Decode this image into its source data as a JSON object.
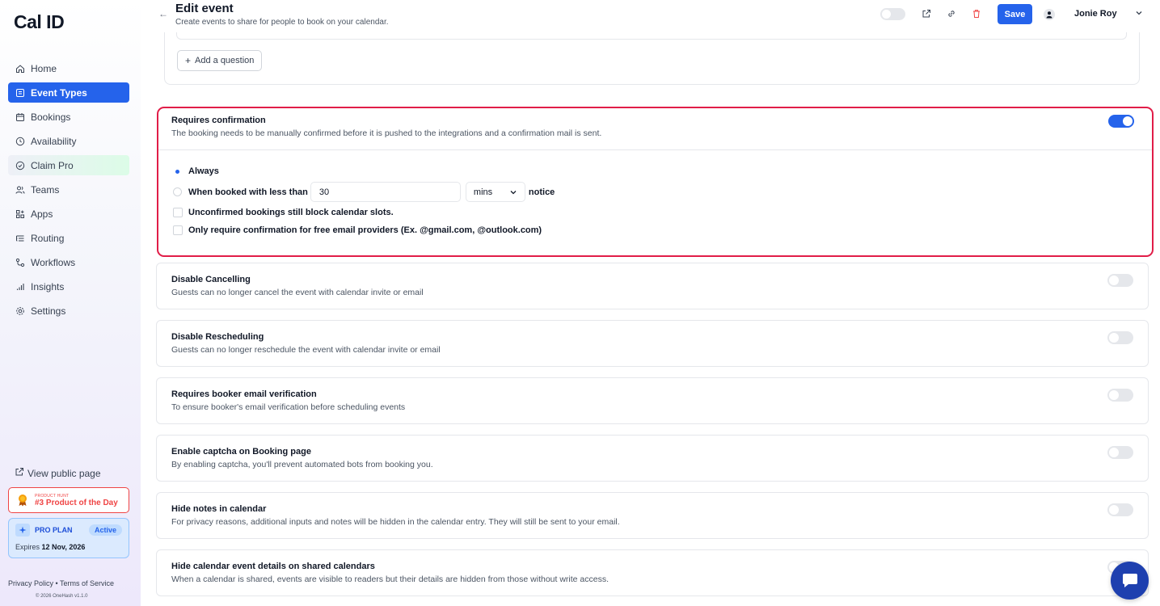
{
  "app": {
    "logo": "Cal ID"
  },
  "sidebar": {
    "items": [
      {
        "label": "Home",
        "icon": "home-icon"
      },
      {
        "label": "Event Types",
        "icon": "event-types-icon",
        "active": true
      },
      {
        "label": "Bookings",
        "icon": "calendar-icon"
      },
      {
        "label": "Availability",
        "icon": "clock-icon"
      },
      {
        "label": "Claim Pro",
        "icon": "badge-icon"
      },
      {
        "label": "Teams",
        "icon": "users-icon"
      },
      {
        "label": "Apps",
        "icon": "grid-plus-icon"
      },
      {
        "label": "Routing",
        "icon": "routing-icon"
      },
      {
        "label": "Workflows",
        "icon": "workflow-icon"
      },
      {
        "label": "Insights",
        "icon": "bar-chart-icon"
      },
      {
        "label": "Settings",
        "icon": "gear-icon"
      }
    ],
    "view_public": "View public page",
    "product_hunt": {
      "small": "PRODUCT HUNT",
      "big": "#3 Product of the Day"
    },
    "plan": {
      "name": "PRO PLAN",
      "status": "Active",
      "expires_label": "Expires",
      "expires_date": "12 Nov, 2026"
    },
    "footer": {
      "privacy": "Privacy Policy",
      "sep": "•",
      "terms": "Terms of Service",
      "copyright": "© 2026 OneHash v1.1.0"
    }
  },
  "header": {
    "back": "←",
    "title": "Edit event",
    "subtitle": "Create events to share for people to book on your calendar.",
    "save_label": "Save",
    "user_name": "Jonie Roy"
  },
  "questions": {
    "add_label": "Add a question"
  },
  "confirmation": {
    "title": "Requires confirmation",
    "desc": "The booking needs to be manually confirmed before it is pushed to the integrations and a confirmation mail is sent.",
    "enabled": true,
    "option_always": "Always",
    "option_less_than": "When booked with less than",
    "threshold_value": "30",
    "unit": "mins",
    "notice": "notice",
    "check_block": "Unconfirmed bookings still block calendar slots.",
    "check_free_email": "Only require confirmation for free email providers (Ex. @gmail.com, @outlook.com)"
  },
  "settings": [
    {
      "title": "Disable Cancelling",
      "desc": "Guests can no longer cancel the event with calendar invite or email",
      "enabled": false
    },
    {
      "title": "Disable Rescheduling",
      "desc": "Guests can no longer reschedule the event with calendar invite or email",
      "enabled": false
    },
    {
      "title": "Requires booker email verification",
      "desc": "To ensure booker's email verification before scheduling events",
      "enabled": false
    },
    {
      "title": "Enable captcha on Booking page",
      "desc": "By enabling captcha, you'll prevent automated bots from booking you.",
      "enabled": false
    },
    {
      "title": "Hide notes in calendar",
      "desc": "For privacy reasons, additional inputs and notes will be hidden in the calendar entry. They will still be sent to your email.",
      "enabled": false
    },
    {
      "title": "Hide calendar event details on shared calendars",
      "desc": "When a calendar is shared, events are visible to readers but their details are hidden from those without write access.",
      "enabled": false
    }
  ],
  "colors": {
    "accent": "#2563eb",
    "highlight_border": "#e11d48",
    "danger": "#ef4444"
  }
}
